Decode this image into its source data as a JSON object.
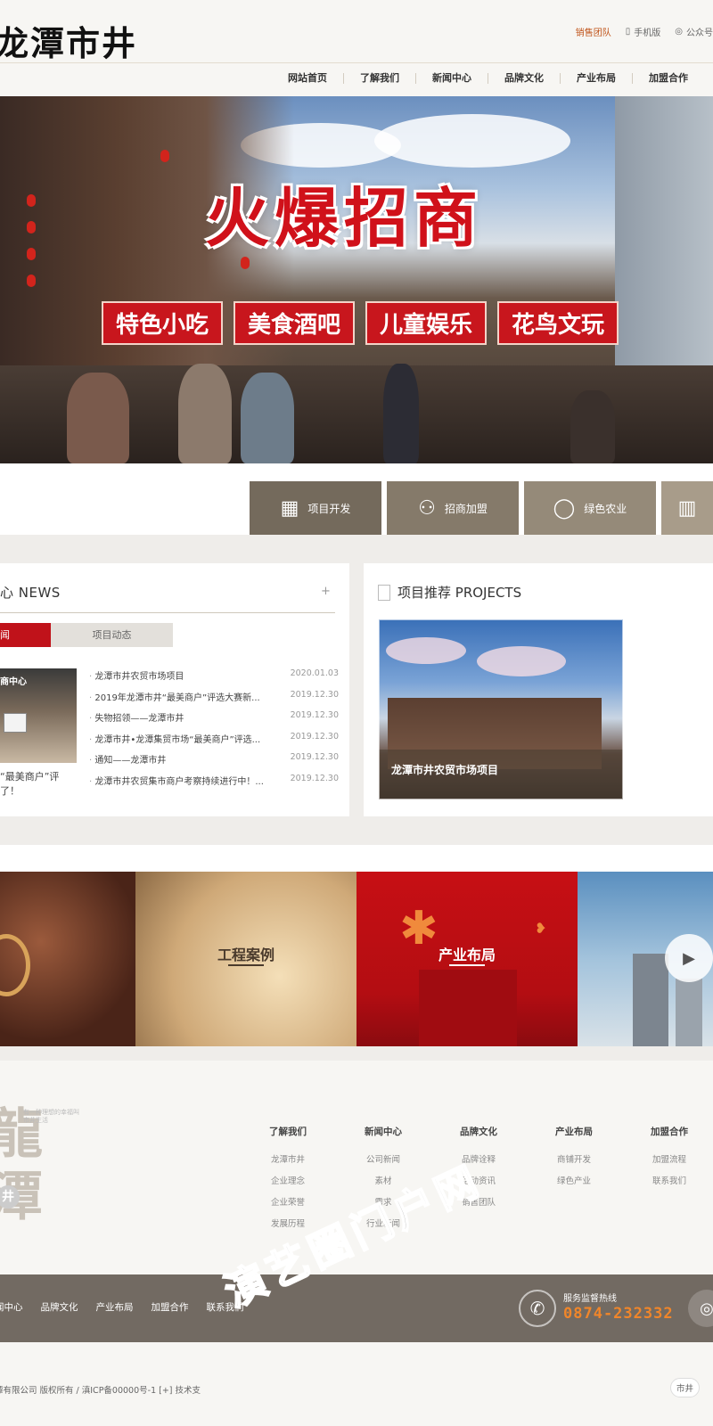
{
  "header": {
    "logo": "龙潭市井",
    "top_links": {
      "sales": "销售团队",
      "mobile": "手机版",
      "wechat": "公众号"
    },
    "nav": [
      "网站首页",
      "了解我们",
      "新闻中心",
      "品牌文化",
      "产业布局",
      "加盟合作"
    ]
  },
  "banner": {
    "title": "火爆招商",
    "tags": [
      "特色小吃",
      "美食酒吧",
      "儿童娱乐",
      "花鸟文玩"
    ]
  },
  "quick_buttons": [
    {
      "label": "项目开发",
      "icon": "building-icon",
      "color": "#746a5c"
    },
    {
      "label": "招商加盟",
      "icon": "people-icon",
      "color": "#857a6a"
    },
    {
      "label": "绿色农业",
      "icon": "bulb-icon",
      "color": "#958a79"
    },
    {
      "label": "",
      "icon": "chart-icon",
      "color": "#a89c8a"
    }
  ],
  "news": {
    "title": "心 NEWS",
    "plus": "+",
    "tab_active": "闻",
    "tab_inactive": "项目动态",
    "image_sign": "商中心",
    "image_caption": "“最美商户”评了！",
    "items": [
      {
        "title": "龙潭市井农贸市场项目",
        "date": "2020.01.03"
      },
      {
        "title": "2019年龙潭市井“最美商户”评选大赛新...",
        "date": "2019.12.30"
      },
      {
        "title": "失物招领——龙潭市井",
        "date": "2019.12.30"
      },
      {
        "title": "龙潭市井•龙潭集贸市场“最美商户”评选...",
        "date": "2019.12.30"
      },
      {
        "title": "通知——龙潭市井",
        "date": "2019.12.30"
      },
      {
        "title": "龙潭市井农贸集市商户考察持续进行中！...",
        "date": "2019.12.30"
      }
    ]
  },
  "projects": {
    "title": "项目推荐 PROJECTS",
    "caption": "龙潭市井农贸市场项目"
  },
  "tiles": [
    {
      "label": ""
    },
    {
      "label": "工程案例"
    },
    {
      "label": "产业布局"
    },
    {
      "label": ""
    }
  ],
  "footer_map": {
    "seal_chars": "龍潭",
    "seal_small": "有一种理想的幸福叫市井生活",
    "seal_mark": "井",
    "columns": [
      {
        "head": "了解我们",
        "links": [
          "龙潭市井",
          "企业理念",
          "企业荣誉",
          "发展历程"
        ]
      },
      {
        "head": "新闻中心",
        "links": [
          "公司新闻",
          "素材",
          "需求",
          "行业新闻"
        ]
      },
      {
        "head": "品牌文化",
        "links": [
          "品牌诠释",
          "活动资讯",
          "销售团队"
        ]
      },
      {
        "head": "产业布局",
        "links": [
          "商铺开发",
          "绿色产业"
        ]
      },
      {
        "head": "加盟合作",
        "links": [
          "加盟流程",
          "联系我们"
        ]
      }
    ]
  },
  "footer_bar": {
    "links": [
      "闻中心",
      "品牌文化",
      "产业布局",
      "加盟合作",
      "联系我们"
    ],
    "hotline_label": "服务监督热线",
    "hotline_number": "0874-232332"
  },
  "copyright": {
    "text": "潭有限公司   版权所有  /  滇ICP备00000号-1    [+] 技术支",
    "chip": "市井"
  },
  "watermark": "演艺圈门户网"
}
